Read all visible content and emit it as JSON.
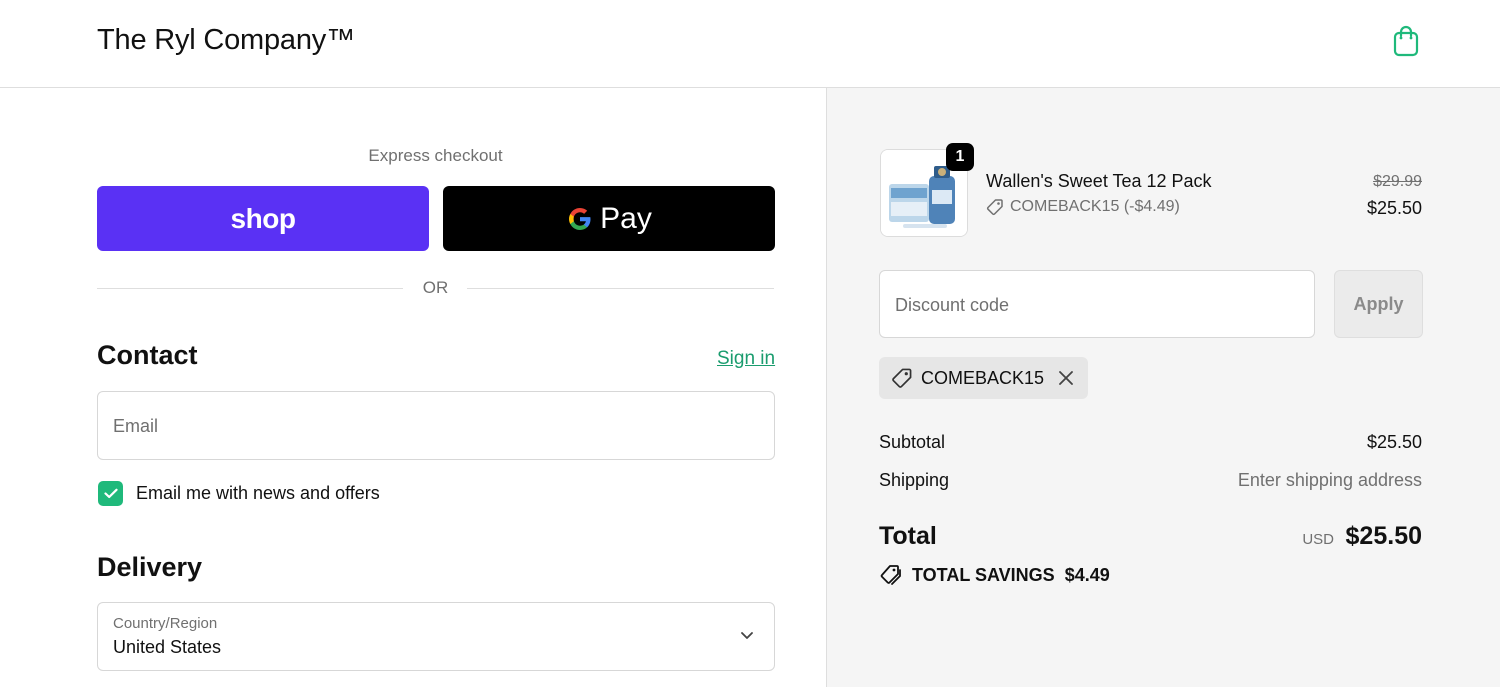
{
  "header": {
    "brand": "The Ryl Company™",
    "cart_icon": "shopping-bag-icon",
    "accent_color": "#1fb97b"
  },
  "express": {
    "label": "Express checkout",
    "shop_label": "shop",
    "gpay_label": "Pay",
    "shop_color": "#5a31f4",
    "or_label": "OR"
  },
  "contact": {
    "heading": "Contact",
    "sign_in": "Sign in",
    "email_placeholder": "Email",
    "newsletter_label": "Email me with news and offers",
    "newsletter_checked": true
  },
  "delivery": {
    "heading": "Delivery",
    "country_label": "Country/Region",
    "country_value": "United States"
  },
  "order": {
    "item": {
      "quantity": "1",
      "name": "Wallen's Sweet Tea 12 Pack",
      "discount_applied": "COMEBACK15 (-$4.49)",
      "original_price": "$29.99",
      "price": "$25.50"
    },
    "discount_placeholder": "Discount code",
    "apply_label": "Apply",
    "applied_code": "COMEBACK15",
    "subtotal_label": "Subtotal",
    "subtotal_value": "$25.50",
    "shipping_label": "Shipping",
    "shipping_value": "Enter shipping address",
    "total_label": "Total",
    "total_currency": "USD",
    "total_value": "$25.50",
    "savings_label": "TOTAL SAVINGS",
    "savings_value": "$4.49"
  }
}
